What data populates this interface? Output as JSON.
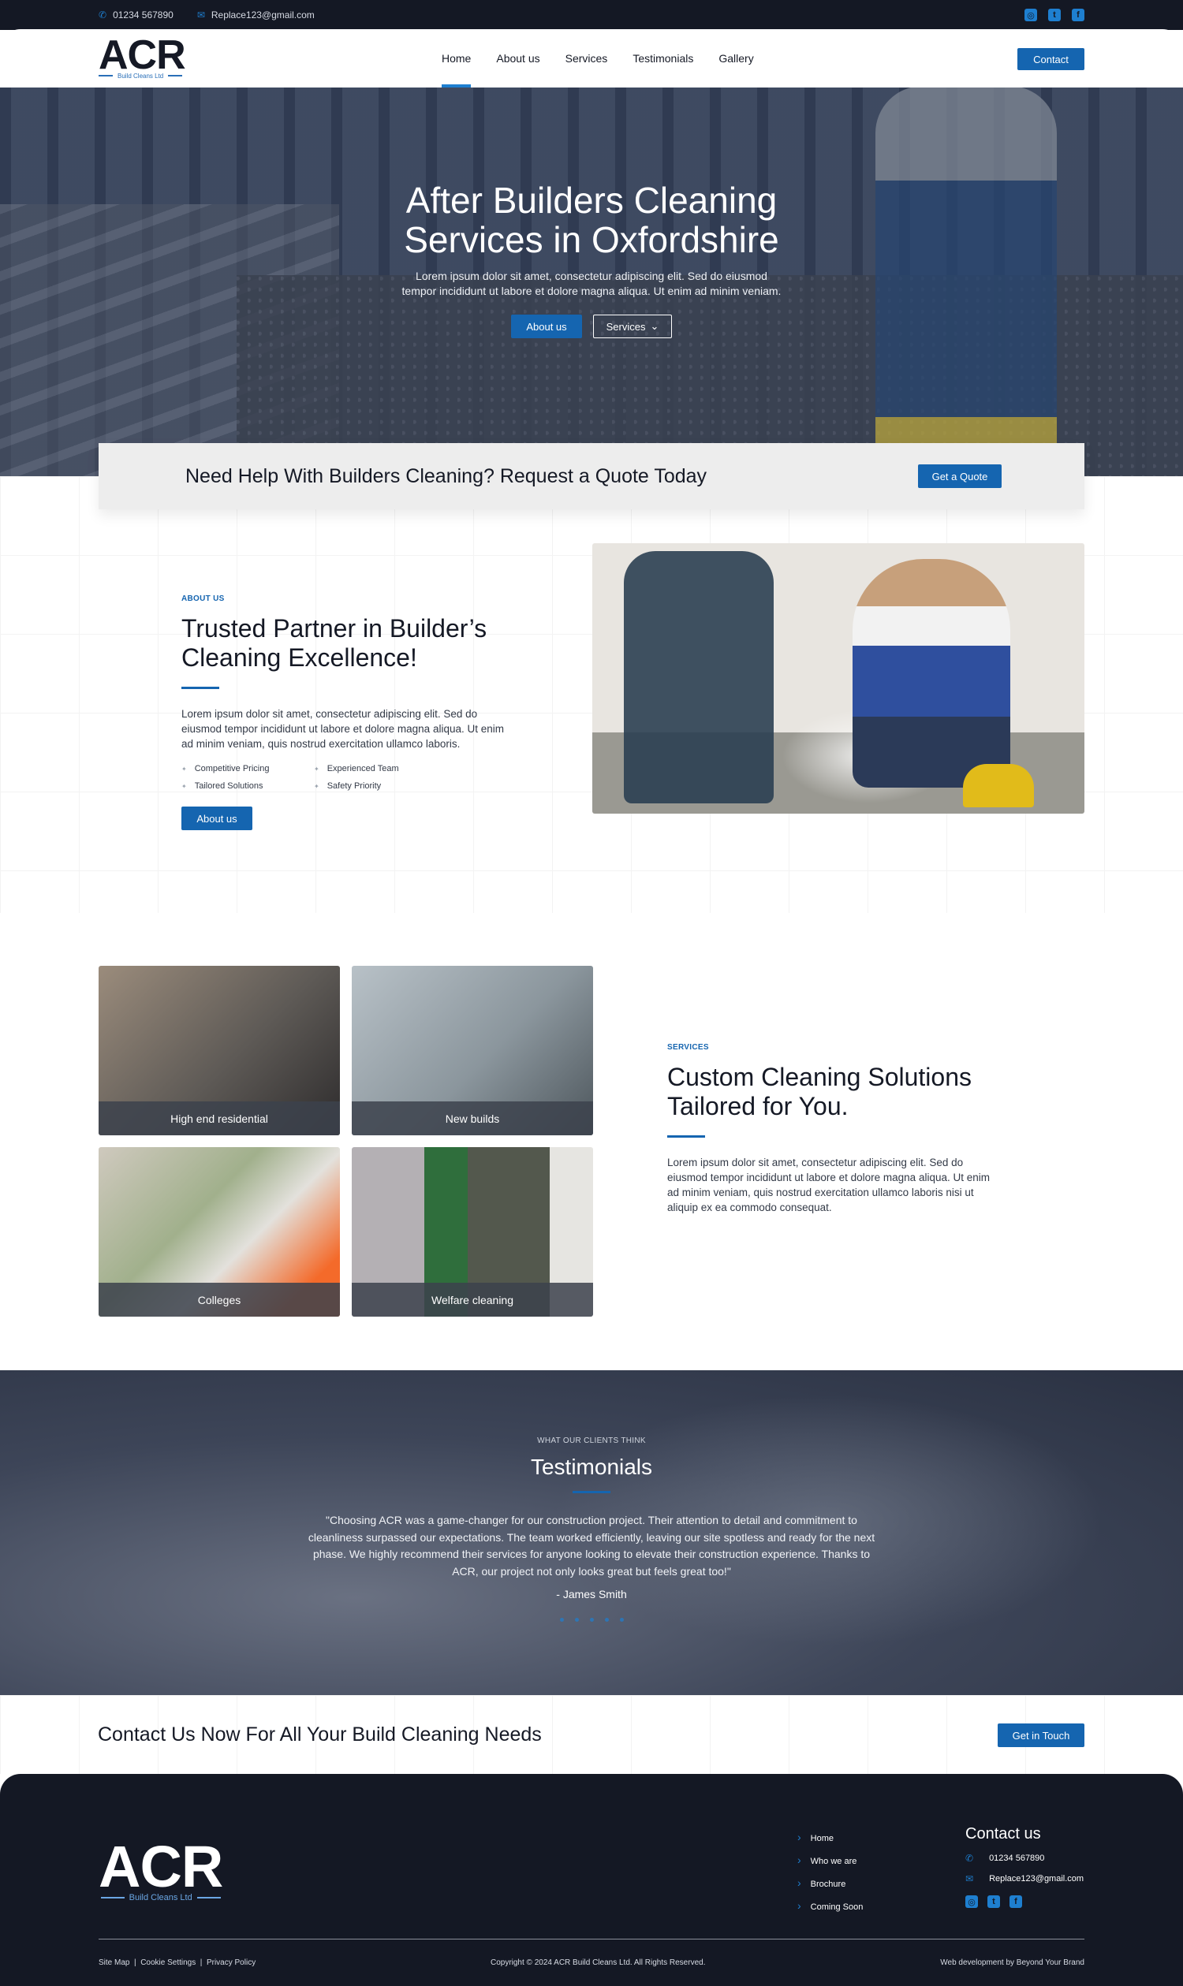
{
  "topbar": {
    "phone": "01234 567890",
    "email": "Replace123@gmail.com",
    "social": [
      {
        "icon": "instagram-icon",
        "glyph": "◎"
      },
      {
        "icon": "twitter-icon",
        "glyph": "t"
      },
      {
        "icon": "facebook-icon",
        "glyph": "f"
      }
    ]
  },
  "brand": {
    "name": "ACR",
    "sub": "Build Cleans Ltd"
  },
  "nav": {
    "items": [
      "Home",
      "About us",
      "Services",
      "Testimonials",
      "Gallery"
    ],
    "active": "Home",
    "contact_label": "Contact"
  },
  "hero": {
    "title_line1": "After Builders Cleaning",
    "title_line2": "Services in Oxfordshire",
    "text_line1": "Lorem ipsum dolor sit amet, consectetur adipiscing elit. Sed do eiusmod",
    "text_line2": "tempor incididunt ut labore et dolore magna aliqua. Ut enim ad minim veniam.",
    "btn_about": "About us",
    "btn_services": "Services"
  },
  "quote_bar": {
    "title": "Need Help With Builders Cleaning? Request a Quote Today",
    "button": "Get a Quote"
  },
  "about": {
    "eyebrow": "ABOUT US",
    "title": "Trusted Partner in Builder’s Cleaning Excellence!",
    "text": "Lorem ipsum dolor sit amet, consectetur adipiscing elit. Sed do eiusmod tempor incididunt ut labore et dolore magna aliqua. Ut enim ad minim veniam, quis nostrud exercitation ullamco laboris.",
    "features": [
      "Competitive Pricing",
      "Experienced Team",
      "Tailored Solutions",
      "Safety Priority"
    ],
    "button": "About us"
  },
  "services": {
    "cards": [
      "High end residential",
      "New builds",
      "Colleges",
      "Welfare cleaning"
    ],
    "eyebrow": "SERVICES",
    "title": "Custom Cleaning Solutions Tailored for You.",
    "text": "Lorem ipsum dolor sit amet, consectetur adipiscing elit. Sed do eiusmod tempor incididunt ut labore et dolore magna aliqua. Ut enim ad minim veniam, quis nostrud exercitation ullamco laboris nisi ut aliquip ex ea commodo consequat."
  },
  "testimonials": {
    "eyebrow": "WHAT OUR CLIENTS THINK",
    "title": "Testimonials",
    "quote": "\"Choosing ACR was a game-changer for our construction project. Their attention to detail and commitment to cleanliness surpassed our expectations. The team worked efficiently, leaving our site spotless and ready for the next phase. We highly recommend their services for anyone looking to elevate their construction experience. Thanks to ACR, our project not only looks great but feels great too!\"",
    "author": "- James Smith"
  },
  "cta": {
    "title": "Contact Us Now For All Your Build Cleaning Needs",
    "button": "Get in Touch"
  },
  "footer": {
    "links": [
      "Home",
      "Who we are",
      "Brochure",
      "Coming Soon"
    ],
    "contact_title": "Contact us",
    "phone": "01234 567890",
    "email": "Replace123@gmail.com",
    "legal": [
      "Site Map",
      "Cookie Settings",
      "Privacy Policy"
    ],
    "copyright": "Copyright © 2024 ACR Build Cleans Ltd. All Rights Reserved.",
    "credit": "Web development by Beyond Your Brand"
  },
  "colors": {
    "accent": "#1565b0",
    "dark": "#141824"
  }
}
